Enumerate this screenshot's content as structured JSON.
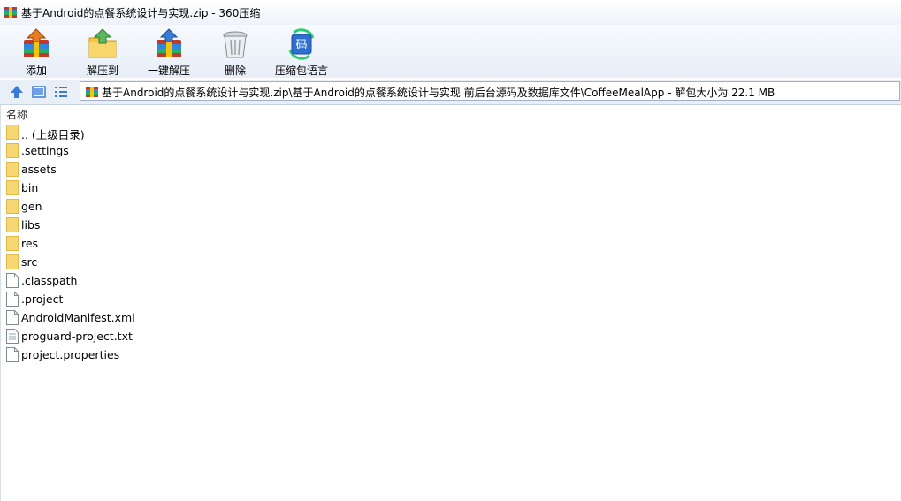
{
  "window": {
    "title": "基于Android的点餐系统设计与实现.zip - 360压缩",
    "app_icon": "archive-icon"
  },
  "toolbar": {
    "buttons": [
      {
        "label": "添加",
        "icon": "add-archive-icon"
      },
      {
        "label": "解压到",
        "icon": "extract-to-icon"
      },
      {
        "label": "一键解压",
        "icon": "one-click-extract-icon"
      },
      {
        "label": "删除",
        "icon": "trash-icon"
      },
      {
        "label": "压缩包语言",
        "icon": "language-encoding-icon",
        "icon_text": "码"
      }
    ]
  },
  "navbar": {
    "path": "基于Android的点餐系统设计与实现.zip\\基于Android的点餐系统设计与实现 前后台源码及数据库文件\\CoffeeMealApp - 解包大小为 22.1 MB"
  },
  "filelist": {
    "column_name": "名称",
    "items": [
      {
        "name": ".. (上级目录)",
        "type": "folder"
      },
      {
        "name": ".settings",
        "type": "folder"
      },
      {
        "name": "assets",
        "type": "folder"
      },
      {
        "name": "bin",
        "type": "folder"
      },
      {
        "name": "gen",
        "type": "folder"
      },
      {
        "name": "libs",
        "type": "folder"
      },
      {
        "name": "res",
        "type": "folder"
      },
      {
        "name": "src",
        "type": "folder"
      },
      {
        "name": ".classpath",
        "type": "file"
      },
      {
        "name": ".project",
        "type": "file"
      },
      {
        "name": "AndroidManifest.xml",
        "type": "file"
      },
      {
        "name": "proguard-project.txt",
        "type": "textfile"
      },
      {
        "name": "project.properties",
        "type": "file"
      }
    ]
  },
  "colors": {
    "folder": "#f7d774",
    "accent": "#3a7bd5"
  }
}
